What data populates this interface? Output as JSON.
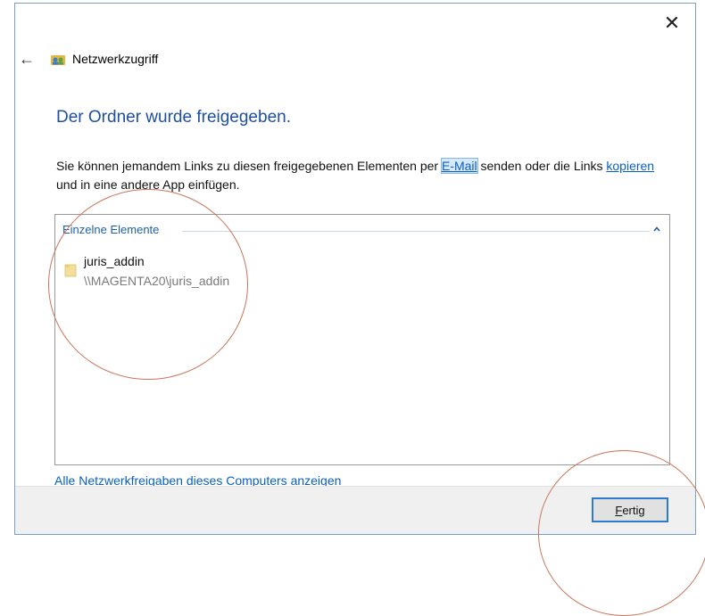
{
  "window": {
    "title": "Netzwerkzugriff",
    "close_symbol": "✕",
    "back_symbol": "←"
  },
  "main": {
    "heading": "Der Ordner wurde freigegeben.",
    "description": {
      "part1": "Sie können jemandem Links zu diesen freigegebenen Elementen per ",
      "email_link": "E-Mail",
      "part2": " senden oder die Links ",
      "copy_link": "kopieren",
      "part3": " und in eine andere App einfügen."
    },
    "group": {
      "header": "Einzelne Elemente",
      "items": [
        {
          "name": "juris_addin",
          "path": "\\\\MAGENTA20\\juris_addin"
        }
      ]
    },
    "all_shares_link": "Alle Netzwerkfreigaben dieses Computers anzeigen"
  },
  "footer": {
    "finish_mnemonic": "F",
    "finish_rest": "ertig"
  },
  "icons": {
    "title": "network-share-icon",
    "folder": "folder-icon",
    "collapse": "chevron-up-icon"
  },
  "colors": {
    "heading": "#1e4fa3",
    "link": "#0a5fc2",
    "annotation": "#c8775a",
    "footer_bg": "#f0f0f0"
  }
}
